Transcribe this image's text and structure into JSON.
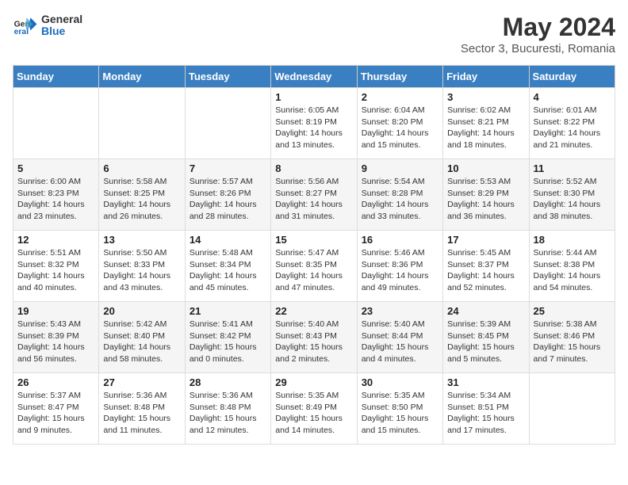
{
  "header": {
    "logo_general": "General",
    "logo_blue": "Blue",
    "main_title": "May 2024",
    "subtitle": "Sector 3, Bucuresti, Romania"
  },
  "days_of_week": [
    "Sunday",
    "Monday",
    "Tuesday",
    "Wednesday",
    "Thursday",
    "Friday",
    "Saturday"
  ],
  "weeks": [
    {
      "days": [
        {
          "number": "",
          "info": ""
        },
        {
          "number": "",
          "info": ""
        },
        {
          "number": "",
          "info": ""
        },
        {
          "number": "1",
          "info": "Sunrise: 6:05 AM\nSunset: 8:19 PM\nDaylight: 14 hours\nand 13 minutes."
        },
        {
          "number": "2",
          "info": "Sunrise: 6:04 AM\nSunset: 8:20 PM\nDaylight: 14 hours\nand 15 minutes."
        },
        {
          "number": "3",
          "info": "Sunrise: 6:02 AM\nSunset: 8:21 PM\nDaylight: 14 hours\nand 18 minutes."
        },
        {
          "number": "4",
          "info": "Sunrise: 6:01 AM\nSunset: 8:22 PM\nDaylight: 14 hours\nand 21 minutes."
        }
      ]
    },
    {
      "days": [
        {
          "number": "5",
          "info": "Sunrise: 6:00 AM\nSunset: 8:23 PM\nDaylight: 14 hours\nand 23 minutes."
        },
        {
          "number": "6",
          "info": "Sunrise: 5:58 AM\nSunset: 8:25 PM\nDaylight: 14 hours\nand 26 minutes."
        },
        {
          "number": "7",
          "info": "Sunrise: 5:57 AM\nSunset: 8:26 PM\nDaylight: 14 hours\nand 28 minutes."
        },
        {
          "number": "8",
          "info": "Sunrise: 5:56 AM\nSunset: 8:27 PM\nDaylight: 14 hours\nand 31 minutes."
        },
        {
          "number": "9",
          "info": "Sunrise: 5:54 AM\nSunset: 8:28 PM\nDaylight: 14 hours\nand 33 minutes."
        },
        {
          "number": "10",
          "info": "Sunrise: 5:53 AM\nSunset: 8:29 PM\nDaylight: 14 hours\nand 36 minutes."
        },
        {
          "number": "11",
          "info": "Sunrise: 5:52 AM\nSunset: 8:30 PM\nDaylight: 14 hours\nand 38 minutes."
        }
      ]
    },
    {
      "days": [
        {
          "number": "12",
          "info": "Sunrise: 5:51 AM\nSunset: 8:32 PM\nDaylight: 14 hours\nand 40 minutes."
        },
        {
          "number": "13",
          "info": "Sunrise: 5:50 AM\nSunset: 8:33 PM\nDaylight: 14 hours\nand 43 minutes."
        },
        {
          "number": "14",
          "info": "Sunrise: 5:48 AM\nSunset: 8:34 PM\nDaylight: 14 hours\nand 45 minutes."
        },
        {
          "number": "15",
          "info": "Sunrise: 5:47 AM\nSunset: 8:35 PM\nDaylight: 14 hours\nand 47 minutes."
        },
        {
          "number": "16",
          "info": "Sunrise: 5:46 AM\nSunset: 8:36 PM\nDaylight: 14 hours\nand 49 minutes."
        },
        {
          "number": "17",
          "info": "Sunrise: 5:45 AM\nSunset: 8:37 PM\nDaylight: 14 hours\nand 52 minutes."
        },
        {
          "number": "18",
          "info": "Sunrise: 5:44 AM\nSunset: 8:38 PM\nDaylight: 14 hours\nand 54 minutes."
        }
      ]
    },
    {
      "days": [
        {
          "number": "19",
          "info": "Sunrise: 5:43 AM\nSunset: 8:39 PM\nDaylight: 14 hours\nand 56 minutes."
        },
        {
          "number": "20",
          "info": "Sunrise: 5:42 AM\nSunset: 8:40 PM\nDaylight: 14 hours\nand 58 minutes."
        },
        {
          "number": "21",
          "info": "Sunrise: 5:41 AM\nSunset: 8:42 PM\nDaylight: 15 hours\nand 0 minutes."
        },
        {
          "number": "22",
          "info": "Sunrise: 5:40 AM\nSunset: 8:43 PM\nDaylight: 15 hours\nand 2 minutes."
        },
        {
          "number": "23",
          "info": "Sunrise: 5:40 AM\nSunset: 8:44 PM\nDaylight: 15 hours\nand 4 minutes."
        },
        {
          "number": "24",
          "info": "Sunrise: 5:39 AM\nSunset: 8:45 PM\nDaylight: 15 hours\nand 5 minutes."
        },
        {
          "number": "25",
          "info": "Sunrise: 5:38 AM\nSunset: 8:46 PM\nDaylight: 15 hours\nand 7 minutes."
        }
      ]
    },
    {
      "days": [
        {
          "number": "26",
          "info": "Sunrise: 5:37 AM\nSunset: 8:47 PM\nDaylight: 15 hours\nand 9 minutes."
        },
        {
          "number": "27",
          "info": "Sunrise: 5:36 AM\nSunset: 8:48 PM\nDaylight: 15 hours\nand 11 minutes."
        },
        {
          "number": "28",
          "info": "Sunrise: 5:36 AM\nSunset: 8:48 PM\nDaylight: 15 hours\nand 12 minutes."
        },
        {
          "number": "29",
          "info": "Sunrise: 5:35 AM\nSunset: 8:49 PM\nDaylight: 15 hours\nand 14 minutes."
        },
        {
          "number": "30",
          "info": "Sunrise: 5:35 AM\nSunset: 8:50 PM\nDaylight: 15 hours\nand 15 minutes."
        },
        {
          "number": "31",
          "info": "Sunrise: 5:34 AM\nSunset: 8:51 PM\nDaylight: 15 hours\nand 17 minutes."
        },
        {
          "number": "",
          "info": ""
        }
      ]
    }
  ]
}
